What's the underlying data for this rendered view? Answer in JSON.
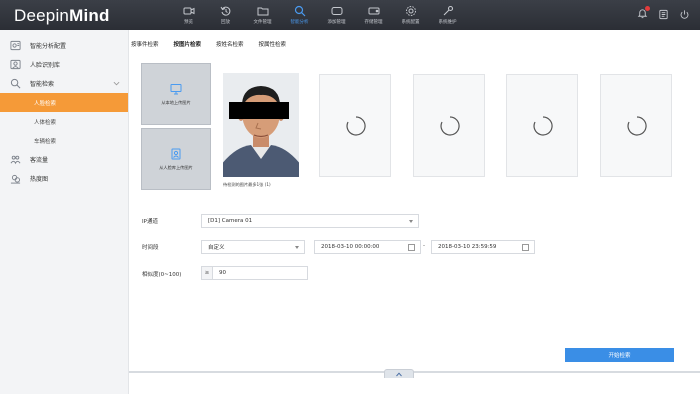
{
  "app": {
    "brand_light": "Deepin",
    "brand_bold": "Mind"
  },
  "topnav": {
    "items": [
      {
        "label": "预览",
        "icon": "camera-icon",
        "active": false
      },
      {
        "label": "回放",
        "icon": "replay-icon",
        "active": false
      },
      {
        "label": "文件管理",
        "icon": "folder-icon",
        "active": false
      },
      {
        "label": "智能分析",
        "icon": "analysis-search-icon",
        "active": true
      },
      {
        "label": "添加管理",
        "icon": "device-icon",
        "active": false
      },
      {
        "label": "存储管理",
        "icon": "storage-icon",
        "active": false
      },
      {
        "label": "系统配置",
        "icon": "gear-icon",
        "active": false
      },
      {
        "label": "系统维护",
        "icon": "wrench-icon",
        "active": false
      }
    ],
    "right_icons": [
      "bell-icon",
      "user-icon",
      "power-icon"
    ]
  },
  "sidebar": {
    "items": [
      {
        "label": "智能分析配置",
        "icon": "analysis-config-icon"
      },
      {
        "label": "人脸识别库",
        "icon": "face-library-icon"
      },
      {
        "label": "智能检索",
        "icon": "smart-search-icon",
        "expanded": true
      }
    ],
    "sub_items": [
      {
        "label": "人脸检索",
        "active": true
      },
      {
        "label": "人体检索",
        "active": false
      },
      {
        "label": "车辆检索",
        "active": false
      }
    ],
    "items_after": [
      {
        "label": "客流量",
        "icon": "people-flow-icon"
      },
      {
        "label": "热度图",
        "icon": "heatmap-icon"
      }
    ]
  },
  "tabs": [
    {
      "label": "按事件检索",
      "active": false
    },
    {
      "label": "按图片检索",
      "active": true
    },
    {
      "label": "按姓名检索",
      "active": false
    },
    {
      "label": "按属性检索",
      "active": false
    }
  ],
  "upload": {
    "local_label": "从本地上传图片",
    "library_label": "从人脸库上传图片"
  },
  "face": {
    "caption": "待检测的图片最多1张 (1)"
  },
  "form": {
    "channel_label": "IP通道",
    "channel_value": "[D1] Camera 01",
    "time_label": "时间段",
    "time_mode_value": "自定义",
    "start_time": "2018-03-10 00:00:00",
    "range_separator": "-",
    "end_time": "2018-03-10 23:59:59",
    "similarity_label": "相似度(0~100)",
    "similarity_prefix": "≥",
    "similarity_value": "90"
  },
  "actions": {
    "start_search": "开始检索"
  },
  "colors": {
    "accent": "#3a8ee6",
    "active_sidebar": "#f59a38",
    "topbar": "#2b2e35"
  }
}
